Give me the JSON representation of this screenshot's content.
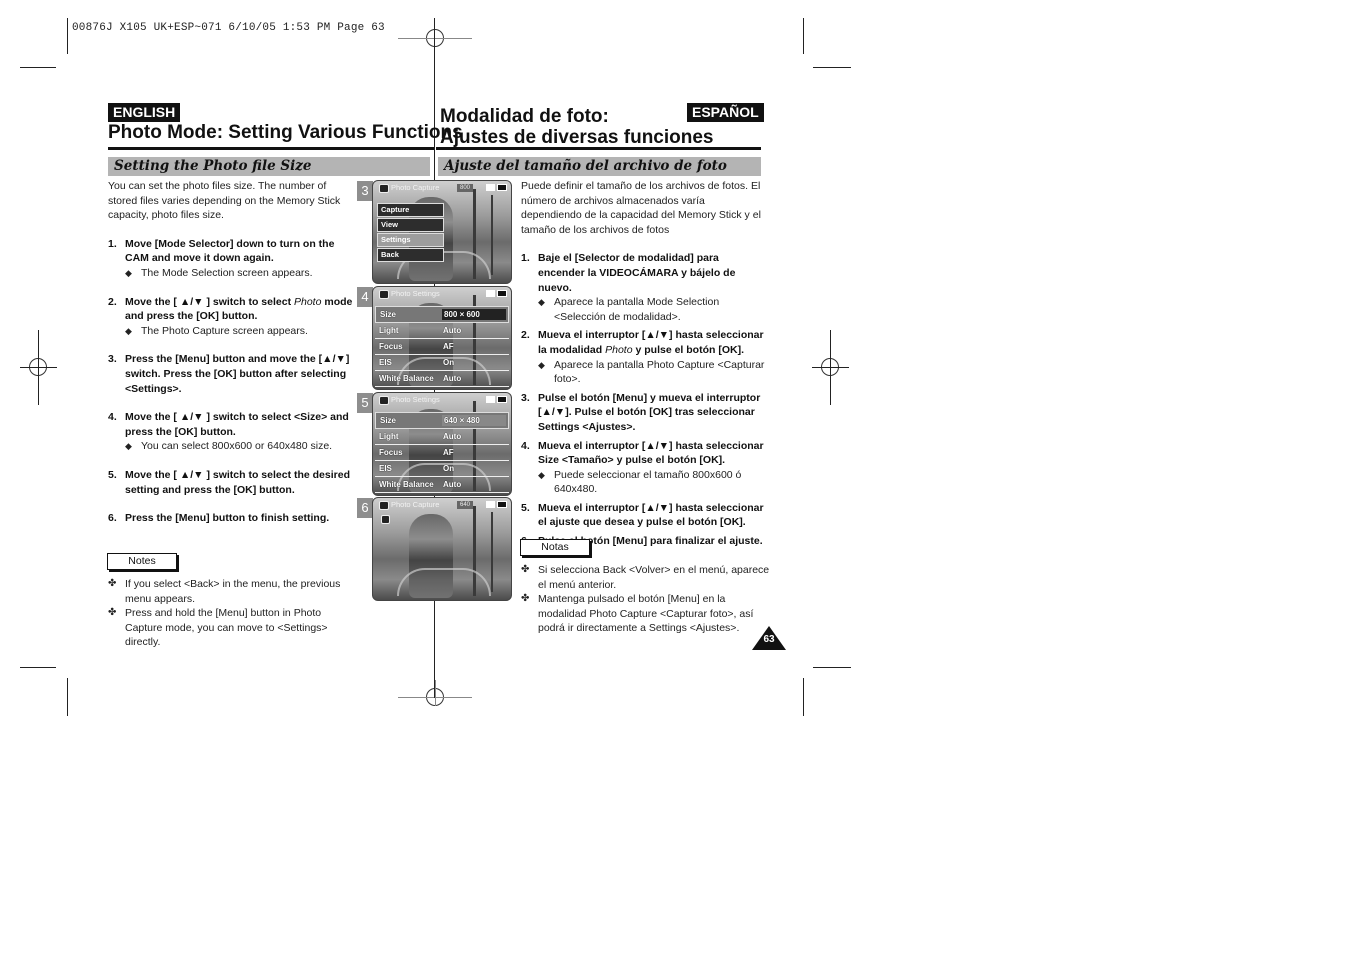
{
  "slug": "00876J X105 UK+ESP~071   6/10/05 1:53 PM   Page 63",
  "english": {
    "lang_tag": "ENGLISH",
    "title": "Photo Mode: Setting Various Functions",
    "section": "Setting the Photo file Size",
    "intro": "You can set the photo files size. The number of stored files varies depending on the Memory Stick capacity, photo files size.",
    "steps": [
      {
        "num": "1.",
        "text": "Move [Mode Selector] down to turn on the CAM and move it down again.",
        "bullet": "The Mode Selection screen appears."
      },
      {
        "num": "2.",
        "text_a": "Move the [ ▲/▼ ] switch to select ",
        "text_em": "Photo",
        "text_b": " mode and press the [OK] button.",
        "bullet": "The Photo Capture screen appears."
      },
      {
        "num": "3.",
        "text": "Press the [Menu] button and move the [▲/▼] switch. Press the [OK] button after selecting <Settings>."
      },
      {
        "num": "4.",
        "text": "Move the [ ▲/▼ ] switch to select <Size> and press the [OK] button.",
        "bullet": "You can select 800x600 or 640x480 size."
      },
      {
        "num": "5.",
        "text": "Move the [ ▲/▼ ] switch to select the desired setting and press the [OK] button."
      },
      {
        "num": "6.",
        "text": "Press the [Menu] button to finish setting."
      }
    ],
    "notes_label": "Notes",
    "notes": [
      "If you select <Back> in the menu, the previous menu appears.",
      "Press and hold the [Menu] button in Photo Capture mode, you can move to <Settings> directly."
    ]
  },
  "spanish": {
    "lang_tag": "ESPAÑOL",
    "title_line1": "Modalidad de foto:",
    "title_line2": "Ajustes de diversas funciones",
    "section": "Ajuste del tamaño del archivo de foto",
    "intro": "Puede definir el tamaño de los archivos de fotos. El número de archivos almacenados varía dependiendo de la capacidad del Memory Stick y el tamaño de los archivos de fotos",
    "steps": [
      {
        "num": "1.",
        "text": "Baje el [Selector de modalidad] para encender la VIDEOCÁMARA y bájelo de nuevo.",
        "bullet": "Aparece la pantalla Mode Selection <Selección de modalidad>."
      },
      {
        "num": "2.",
        "text_a": "Mueva el interruptor [▲/▼] hasta seleccionar la modalidad ",
        "text_em": "Photo",
        "text_b": " y pulse el botón [OK].",
        "bullet": "Aparece la pantalla Photo Capture <Capturar foto>."
      },
      {
        "num": "3.",
        "text": "Pulse el botón [Menu] y mueva el interruptor [▲/▼]. Pulse el botón [OK] tras seleccionar Settings <Ajustes>."
      },
      {
        "num": "4.",
        "text": "Mueva el interruptor [▲/▼] hasta seleccionar Size <Tamaño> y pulse el botón [OK].",
        "bullet": "Puede seleccionar el tamaño 800x600 ó 640x480."
      },
      {
        "num": "5.",
        "text": "Mueva el interruptor [▲/▼] hasta seleccionar el ajuste que desea y pulse el botón [OK]."
      },
      {
        "num": "6.",
        "text": "Pulse el botón [Menu] para finalizar el ajuste."
      }
    ],
    "notes_label": "Notas",
    "notes": [
      "Si selecciona Back <Volver> en el menú, aparece el menú anterior.",
      "Mantenga pulsado el botón [Menu] en la modalidad Photo Capture <Capturar foto>, así podrá ir directamente a Settings <Ajustes>."
    ]
  },
  "screens": [
    {
      "num": "3",
      "header": "Photo Capture",
      "res": "800",
      "menu": [
        "Capture",
        "View",
        "Settings",
        "Back"
      ],
      "selected": "Settings"
    },
    {
      "num": "4",
      "header": "Photo Settings",
      "rows": [
        {
          "k": "Size",
          "v": "800 × 600"
        },
        {
          "k": "Light",
          "v": "Auto"
        },
        {
          "k": "Focus",
          "v": "AF"
        },
        {
          "k": "EIS",
          "v": "On"
        },
        {
          "k": "White Balance",
          "v": "Auto"
        }
      ]
    },
    {
      "num": "5",
      "header": "Photo Settings",
      "rows": [
        {
          "k": "Size",
          "v": "640 × 480"
        },
        {
          "k": "Light",
          "v": "Auto"
        },
        {
          "k": "Focus",
          "v": "AF"
        },
        {
          "k": "EIS",
          "v": "On"
        },
        {
          "k": "White Balance",
          "v": "Auto"
        }
      ]
    },
    {
      "num": "6",
      "header": "Photo Capture",
      "res": "640"
    }
  ],
  "page_number": "63",
  "bullet_glyph": "◆",
  "note_glyph": "✤"
}
